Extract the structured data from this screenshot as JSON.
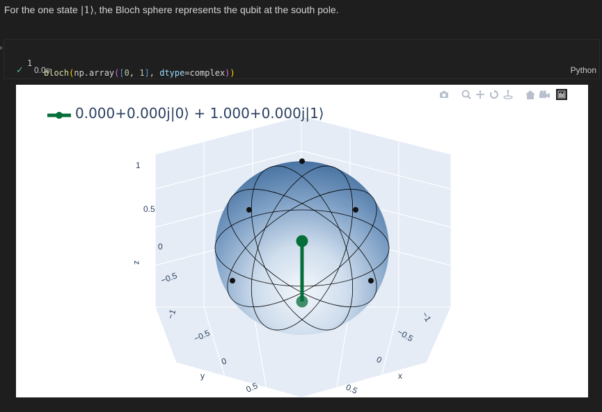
{
  "intro": {
    "before": "For the one state ",
    "ket": "|1⟩",
    "after": ", the Bloch sphere represents the qubit at the south pole."
  },
  "cell": {
    "line_number": "1",
    "code": {
      "fn": "bloch",
      "arg_prefix": "np.array",
      "list_values": [
        "0",
        "1"
      ],
      "kwarg": "dtype",
      "kwarg_value": "complex"
    },
    "status_icon": "check-icon",
    "duration": "0.0s",
    "language": "Python"
  },
  "plot": {
    "legend_label": "0.000+0.000j|0⟩ + 1.000+0.000j|1⟩",
    "trace_color": "#056e39",
    "sphere_color": "#4a76a8",
    "z_axis": {
      "title": "z",
      "ticks": [
        "1",
        "0.5",
        "0",
        "−0.5",
        "−1"
      ]
    },
    "y_axis": {
      "title": "y",
      "ticks": [
        "−0.5",
        "0",
        "0.5"
      ]
    },
    "x_axis": {
      "title": "x",
      "ticks": [
        "−1",
        "−0.5",
        "0",
        "0.5"
      ]
    },
    "modebar": [
      "camera-icon",
      "zoom-icon",
      "pan-icon",
      "orbit-icon",
      "turntable-icon",
      "home-icon",
      "video-camera-icon",
      "plotly-logo-icon"
    ]
  },
  "chart_data": {
    "type": "scatter",
    "title": "",
    "series": [
      {
        "name": "0.000+0.000j|0⟩ + 1.000+0.000j|1⟩",
        "x": [
          0,
          0
        ],
        "y": [
          0,
          0
        ],
        "z": [
          0,
          -1
        ]
      }
    ],
    "reference_points": {
      "x": [
        0,
        0.707,
        -0.707,
        0.707,
        -0.707,
        0
      ],
      "y": [
        0,
        0.707,
        0.707,
        -0.707,
        -0.707,
        0
      ],
      "z": [
        1,
        0,
        0,
        0,
        0,
        -1
      ]
    },
    "xlim": [
      -1,
      1
    ],
    "ylim": [
      -1,
      1
    ],
    "zlim": [
      -1,
      1
    ],
    "grid": true,
    "legend_position": "top-left"
  }
}
